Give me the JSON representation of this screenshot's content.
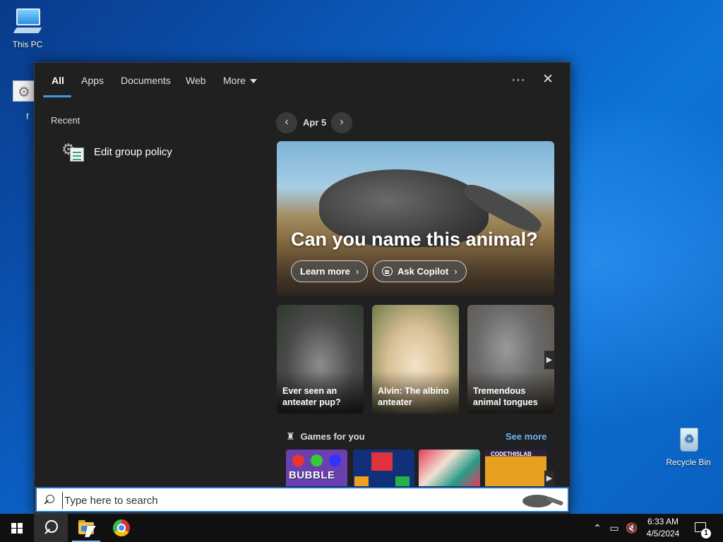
{
  "desktop": {
    "icons": [
      {
        "label": "This PC"
      },
      {
        "label": "Recycle Bin"
      },
      {
        "label": "f"
      }
    ]
  },
  "search_panel": {
    "tabs": [
      {
        "label": "All",
        "active": true
      },
      {
        "label": "Apps"
      },
      {
        "label": "Documents"
      },
      {
        "label": "Web"
      },
      {
        "label": "More"
      }
    ],
    "more_options_glyph": "···",
    "close_glyph": "✕",
    "recent": {
      "title": "Recent",
      "items": [
        {
          "label": "Edit group policy",
          "icon": "group-policy-icon"
        }
      ]
    },
    "highlights": {
      "date": "Apr 5",
      "hero": {
        "title": "Can you name this animal?",
        "learn_more": "Learn more",
        "ask_copilot": "Ask Copilot"
      },
      "cards": [
        {
          "caption": "Ever seen an anteater pup?"
        },
        {
          "caption": "Alvin: The albino anteater"
        },
        {
          "caption": "Tremendous animal tongues"
        }
      ],
      "games": {
        "title": "Games for you",
        "see_more": "See more",
        "tiles": [
          {
            "text": "BUBBLE"
          },
          {
            "text": ""
          },
          {
            "text": ""
          },
          {
            "text": "CODETHISLAB"
          }
        ]
      }
    }
  },
  "search_box": {
    "placeholder": "Type here to search",
    "value": ""
  },
  "taskbar": {
    "clock_time": "6:33 AM",
    "clock_date": "4/5/2024",
    "notification_count": "1",
    "colors": {
      "accent": "#1a73d9",
      "background": "#101010"
    }
  }
}
